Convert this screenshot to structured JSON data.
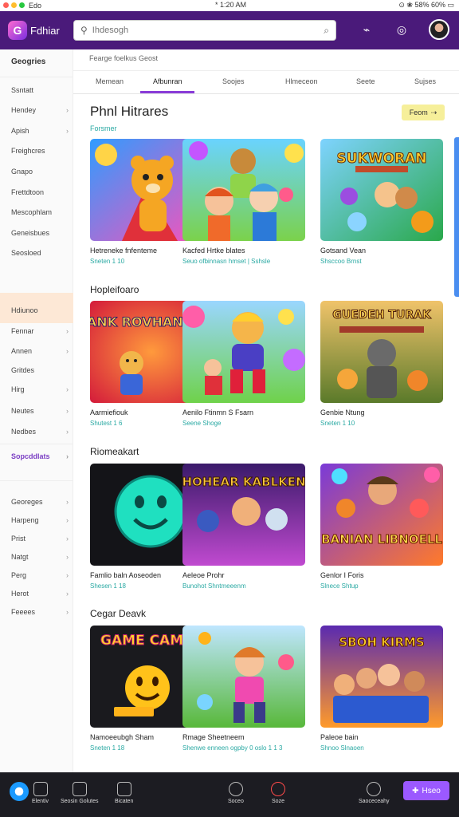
{
  "status": {
    "app": "Edo",
    "time": "* 1:20 AM",
    "right": "⊙ ❀ 58% 60% ▭",
    "dot_colors": [
      "#ff5f57",
      "#ffbd2e",
      "#28c840"
    ]
  },
  "header": {
    "brand": "Fdhiar",
    "search_placeholder": "Ihdesogh",
    "icons": [
      "tag-icon",
      "compass-icon"
    ]
  },
  "sidebar": {
    "title": "Geogries",
    "group1": [
      "Ssntatt",
      "Hendey",
      "Apish",
      "Freighcres",
      "Gnapo",
      "Frettdtoon",
      "Mescophlam",
      "Geneisbues",
      "Seosloed"
    ],
    "active": "Hdiunoo",
    "group2": [
      "Fennar",
      "Annen",
      "Gritdes",
      "Hirg",
      "Neutes",
      "Nedbes"
    ],
    "special": "Sopcddlats",
    "group3": [
      "Georeges",
      "Harpeng",
      "Prist",
      "Natgt",
      "Perg",
      "Herot",
      "Feeees"
    ]
  },
  "main": {
    "breadcrumb": "Fearge foelkus Geost",
    "tabs": [
      "Memean",
      "Afbunran",
      "Soojes",
      "Hlmeceon",
      "Seete",
      "Sujses"
    ],
    "view_button": "Feom",
    "sections": [
      {
        "title": "Phnl Hitrares",
        "subtitle": "Forsmer",
        "cards": [
          {
            "title": "Hetreneke fnfenteme",
            "meta": "Sneten 1 10"
          },
          {
            "title": "Kacfed Hrtke blates",
            "meta": "Seuo ofbinnasn hmset | Sshsle"
          },
          {
            "title": "Gotsand Vean",
            "meta": "Shsccoo Brnst"
          }
        ]
      },
      {
        "title": "Hopleifoaro",
        "cards": [
          {
            "title": "Aarmiefiouk",
            "meta": "Shutest 1 6"
          },
          {
            "title": "Aenilo Ftinmn S Fsarn",
            "meta": "Seene Shoge"
          },
          {
            "title": "Genbie Ntung",
            "meta": "Sneten 1 10"
          }
        ]
      },
      {
        "title": "Riomeakart",
        "cards": [
          {
            "title": "Famlio baln Aoseoden",
            "meta": "Shesen 1 18"
          },
          {
            "title": "Aeleoe Prohr",
            "meta": "Bunohot Shntmeeenm"
          },
          {
            "title": "Genlor I Foris",
            "meta": "Slnece Shtup"
          }
        ]
      },
      {
        "title": "Cegar Deavk",
        "cards": [
          {
            "title": "Namoeeubgh Sham",
            "meta": "Sneten 1 18"
          },
          {
            "title": "Rmage Sheetneem",
            "meta": "Shenwe enneen ogpby 0 oslo 1 1 3"
          },
          {
            "title": "Paleoe bain",
            "meta": "Shnoo Slnaoen"
          }
        ]
      }
    ],
    "art_text": {
      "a": "SUKWORAN",
      "b": "DUANK ROVHAND",
      "c": "GUEDEH TURAK",
      "d": "HOHEAR KABLKEN",
      "e": "BANIAN LIBNOELL",
      "f": "GAME CAMES",
      "g": "SBOH KIRMS"
    }
  },
  "bottom": {
    "items": [
      "Elentiv",
      "Seosin Golutes",
      "Bicaten",
      "Soceo",
      "Soze",
      "Saoceceahy"
    ],
    "cta": "Hseo"
  }
}
